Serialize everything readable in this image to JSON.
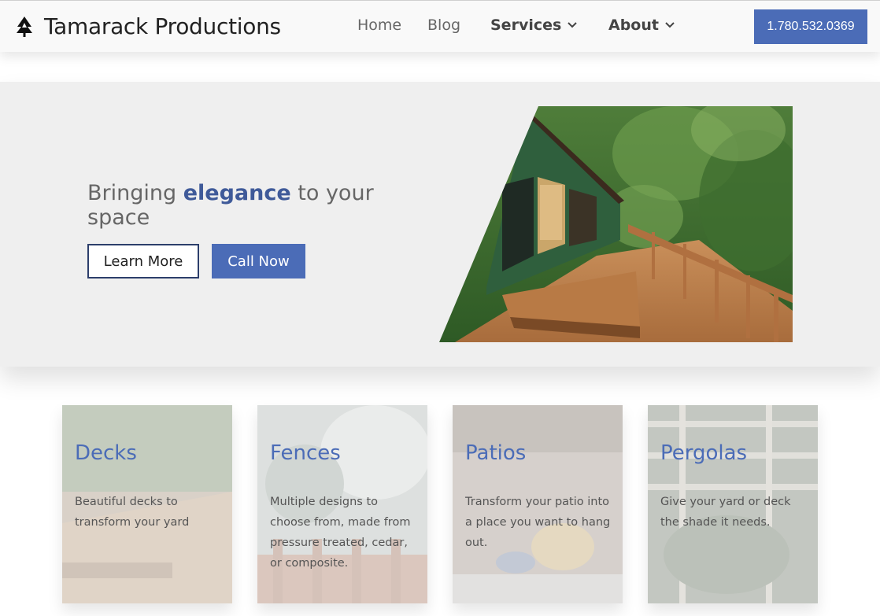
{
  "header": {
    "brand": "Tamarack Productions",
    "nav": {
      "home": "Home",
      "blog": "Blog",
      "services": "Services",
      "about": "About"
    },
    "phone": "1.780.532.0369"
  },
  "hero": {
    "title_pre": "Bringing ",
    "title_em": "elegance",
    "title_post": " to your space",
    "learn_more": "Learn More",
    "call_now": "Call Now"
  },
  "cards": [
    {
      "title": "Decks",
      "text": "Beautiful decks to transform your yard"
    },
    {
      "title": "Fences",
      "text": "Multiple designs to choose from, made from pressure treated, cedar, or composite."
    },
    {
      "title": "Patios",
      "text": "Transform your patio into a place you want to hang out."
    },
    {
      "title": "Pergolas",
      "text": "Give your yard or deck the shade it needs."
    }
  ],
  "colors": {
    "accent": "#4b6cb7",
    "title_accent": "#3f5a99",
    "hero_bg": "#efefef"
  }
}
